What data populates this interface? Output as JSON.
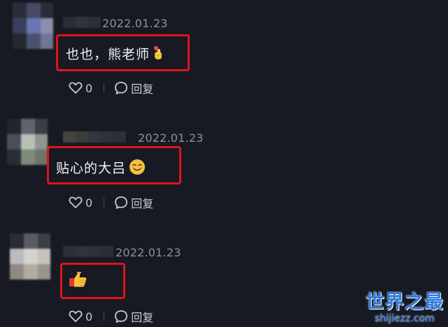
{
  "comments": [
    {
      "date": "2022.01.23",
      "text": "也也，熊老师",
      "emoji": "finger-heart",
      "likes": "0",
      "reply_label": "回复"
    },
    {
      "date": "2022.01.23",
      "text": "贴心的大吕",
      "emoji": "smiling-face",
      "likes": "0",
      "reply_label": "回复"
    },
    {
      "date": "2022.01.23",
      "text": "",
      "emoji": "thumbs-up",
      "likes": "0",
      "reply_label": "回复"
    }
  ],
  "watermark": {
    "title": "世界之最",
    "subtitle": "shijiezz.com"
  },
  "colors": {
    "background": "#171923",
    "highlight_border": "#e0141b",
    "date_text": "#8e919b",
    "watermark": "#2f7be0"
  }
}
